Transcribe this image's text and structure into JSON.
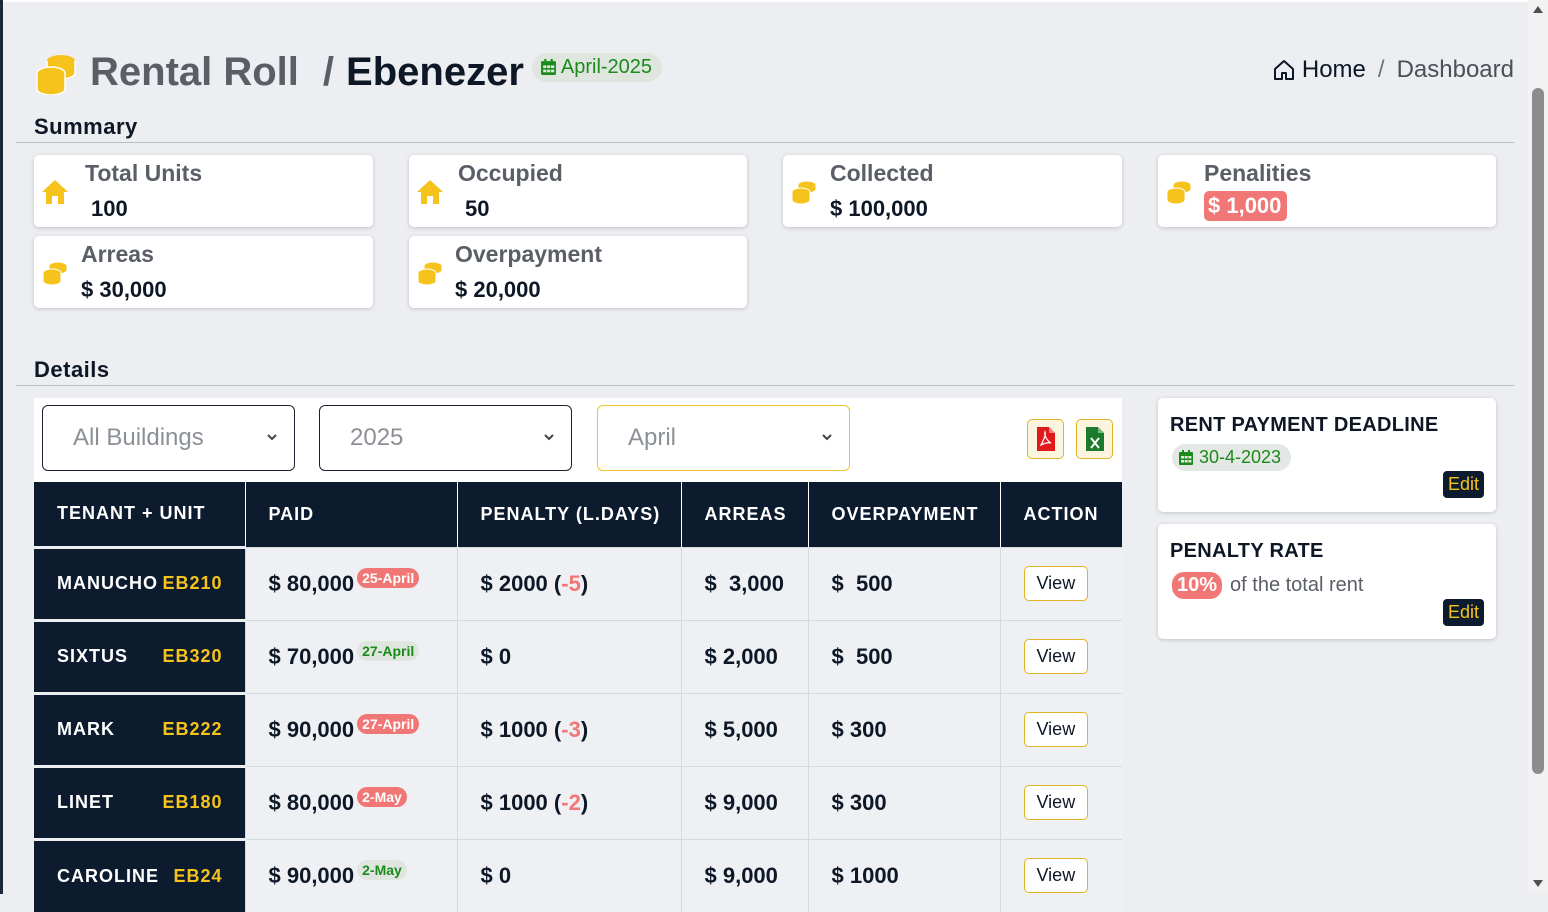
{
  "header": {
    "title": "Rental Roll",
    "separator": "/",
    "building": "Ebenezer",
    "period": "April-2025",
    "icon": "coins-icon"
  },
  "breadcrumb": {
    "home": "Home",
    "separator": "/",
    "current": "Dashboard"
  },
  "summary": {
    "title": "Summary",
    "cards": {
      "total_units": {
        "label": "Total Units",
        "value": "100",
        "icon": "house-icon"
      },
      "occupied": {
        "label": "Occupied",
        "value": "50",
        "icon": "house-icon"
      },
      "collected": {
        "label": "Collected",
        "value": "$ 100,000",
        "icon": "coins-icon"
      },
      "penalities": {
        "label": "Penalities",
        "value": "$ 1,000",
        "icon": "coins-icon"
      },
      "arreas": {
        "label": "Arreas",
        "value": "$ 30,000",
        "icon": "coins-icon"
      },
      "overpayment": {
        "label": "Overpayment",
        "value": "$ 20,000",
        "icon": "coins-icon"
      }
    }
  },
  "details": {
    "title": "Details",
    "filters": {
      "building": "All Buildings",
      "year": "2025",
      "month": "April"
    },
    "export": {
      "pdf_icon": "pdf-file-icon",
      "excel_icon": "excel-file-icon"
    },
    "columns": [
      "TENANT + UNIT",
      "PAID",
      "PENALTY (L.DAYS)",
      "ARREAS",
      "OVERPAYMENT",
      "ACTION"
    ],
    "rows": [
      {
        "tenant": "MANUCHO",
        "unit": "EB210",
        "paid": "$ 80,000",
        "paid_date": "25-April",
        "late": true,
        "penalty": "$ 2000",
        "late_days": "-5",
        "arreas": "$  3,000",
        "overpayment": "$  500",
        "action": "View"
      },
      {
        "tenant": "SIXTUS",
        "unit": "EB320",
        "paid": "$ 70,000",
        "paid_date": "27-April",
        "late": false,
        "penalty": "$ 0",
        "late_days": "",
        "arreas": "$ 2,000",
        "overpayment": "$  500",
        "action": "View"
      },
      {
        "tenant": "MARK",
        "unit": "EB222",
        "paid": "$ 90,000",
        "paid_date": "27-April",
        "late": true,
        "penalty": "$ 1000",
        "late_days": "-3",
        "arreas": "$ 5,000",
        "overpayment": "$ 300",
        "action": "View"
      },
      {
        "tenant": "LINET",
        "unit": "EB180",
        "paid": "$ 80,000",
        "paid_date": "2-May",
        "late": true,
        "penalty": "$ 1000",
        "late_days": "-2",
        "arreas": "$ 9,000",
        "overpayment": "$ 300",
        "action": "View"
      },
      {
        "tenant": "CAROLINE",
        "unit": "EB24",
        "paid": "$ 90,000",
        "paid_date": "2-May",
        "late": false,
        "penalty": "$ 0",
        "late_days": "",
        "arreas": "$ 9,000",
        "overpayment": "$ 1000",
        "action": "View"
      }
    ]
  },
  "deadline": {
    "title": "RENT PAYMENT DEADLINE",
    "date": "30-4-2023",
    "edit": "Edit"
  },
  "penalty_rate": {
    "title": "PENALTY RATE",
    "rate": "10%",
    "text": "of the total rent",
    "edit": "Edit"
  },
  "colors": {
    "navy": "#0d1b2e",
    "gold": "#f5c31c",
    "red": "#f07775",
    "green": "#1b8a1b"
  }
}
